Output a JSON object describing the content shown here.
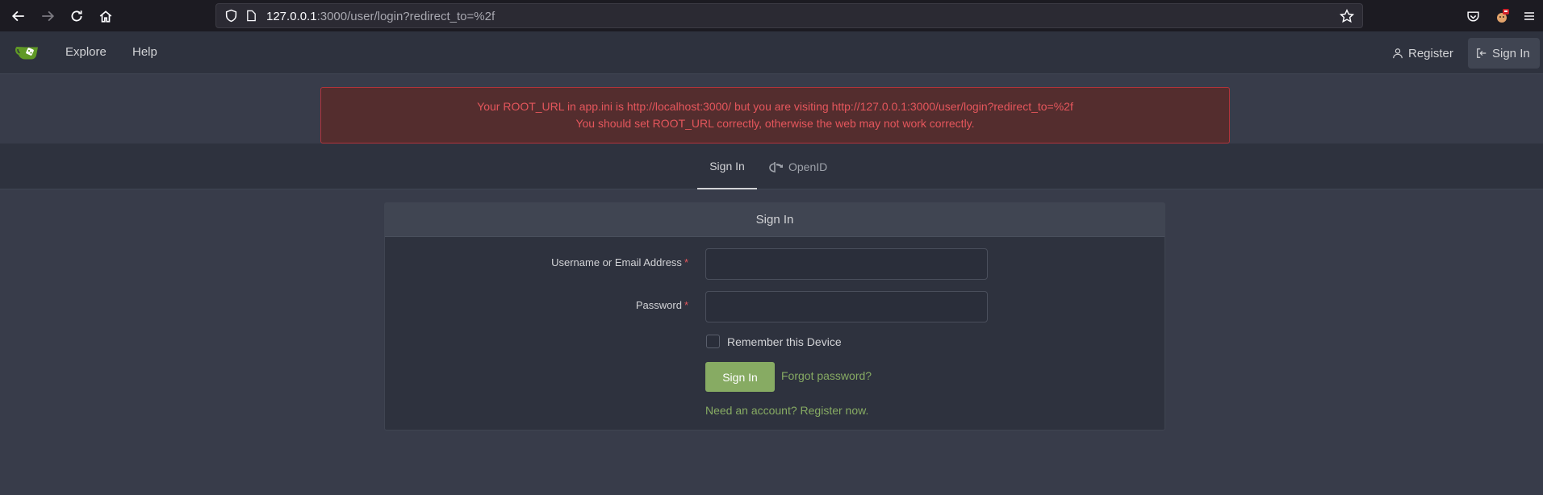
{
  "browser": {
    "url_host": "127.0.0.1",
    "url_rest": ":3000/user/login?redirect_to=%2f"
  },
  "header": {
    "nav": {
      "explore": "Explore",
      "help": "Help"
    },
    "register": "Register",
    "sign_in": "Sign In"
  },
  "warning": {
    "line1": "Your ROOT_URL in app.ini is http://localhost:3000/ but you are visiting http://127.0.0.1:3000/user/login?redirect_to=%2f",
    "line2": "You should set ROOT_URL correctly, otherwise the web may not work correctly."
  },
  "tabs": {
    "sign_in": "Sign In",
    "openid": "OpenID"
  },
  "form": {
    "title": "Sign In",
    "username_label": "Username or Email Address",
    "password_label": "Password",
    "required_mark": "*",
    "username_value": "",
    "password_value": "",
    "remember_label": "Remember this Device",
    "submit": "Sign In",
    "forgot": "Forgot password?",
    "register_link": "Need an account? Register now."
  },
  "colors": {
    "accent": "#87ab63",
    "warning_text": "#e5565c",
    "background": "#383c4a"
  },
  "icons": [
    "back-icon",
    "forward-icon",
    "reload-icon",
    "home-icon",
    "shield-icon",
    "page-icon",
    "bookmark-star-icon",
    "pocket-icon",
    "extension-icon",
    "menu-icon",
    "gitea-logo-icon",
    "user-icon",
    "sign-in-icon",
    "openid-icon"
  ]
}
